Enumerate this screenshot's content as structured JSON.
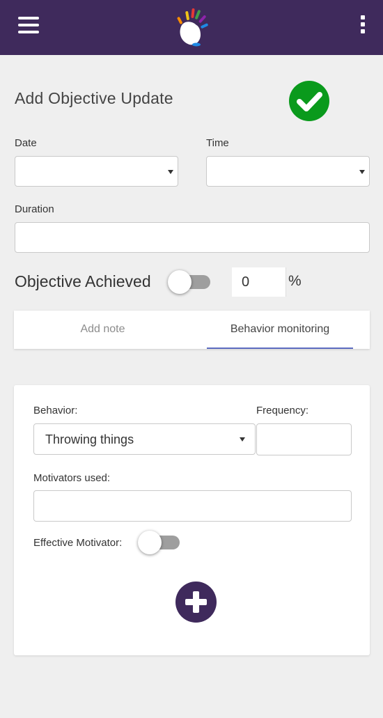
{
  "appbar": {
    "menu_icon": "hamburger-menu-icon",
    "logo": "colorful-hand-logo",
    "more_icon": "more-vert-icon",
    "color": "#3f2a5c"
  },
  "form": {
    "title": "Add Objective Update",
    "save_icon": "check-circle-icon",
    "save_color": "#0a9a1c",
    "date_label": "Date",
    "date_value": "",
    "time_label": "Time",
    "time_value": "",
    "duration_label": "Duration",
    "duration_value": "",
    "achieved_label": "Objective Achieved",
    "achieved_on": false,
    "achieved_percent": "0",
    "percent_sign": "%"
  },
  "tabs": {
    "add_note": "Add note",
    "behavior_monitoring": "Behavior monitoring",
    "active": "behavior_monitoring"
  },
  "behavior": {
    "behavior_label": "Behavior:",
    "behavior_value": "Throwing things",
    "frequency_label": "Frequency:",
    "frequency_value": "",
    "motivators_label": "Motivators used:",
    "motivators_value": "",
    "effective_label": "Effective Motivator:",
    "effective_on": false,
    "add_icon": "add-circle-icon"
  }
}
